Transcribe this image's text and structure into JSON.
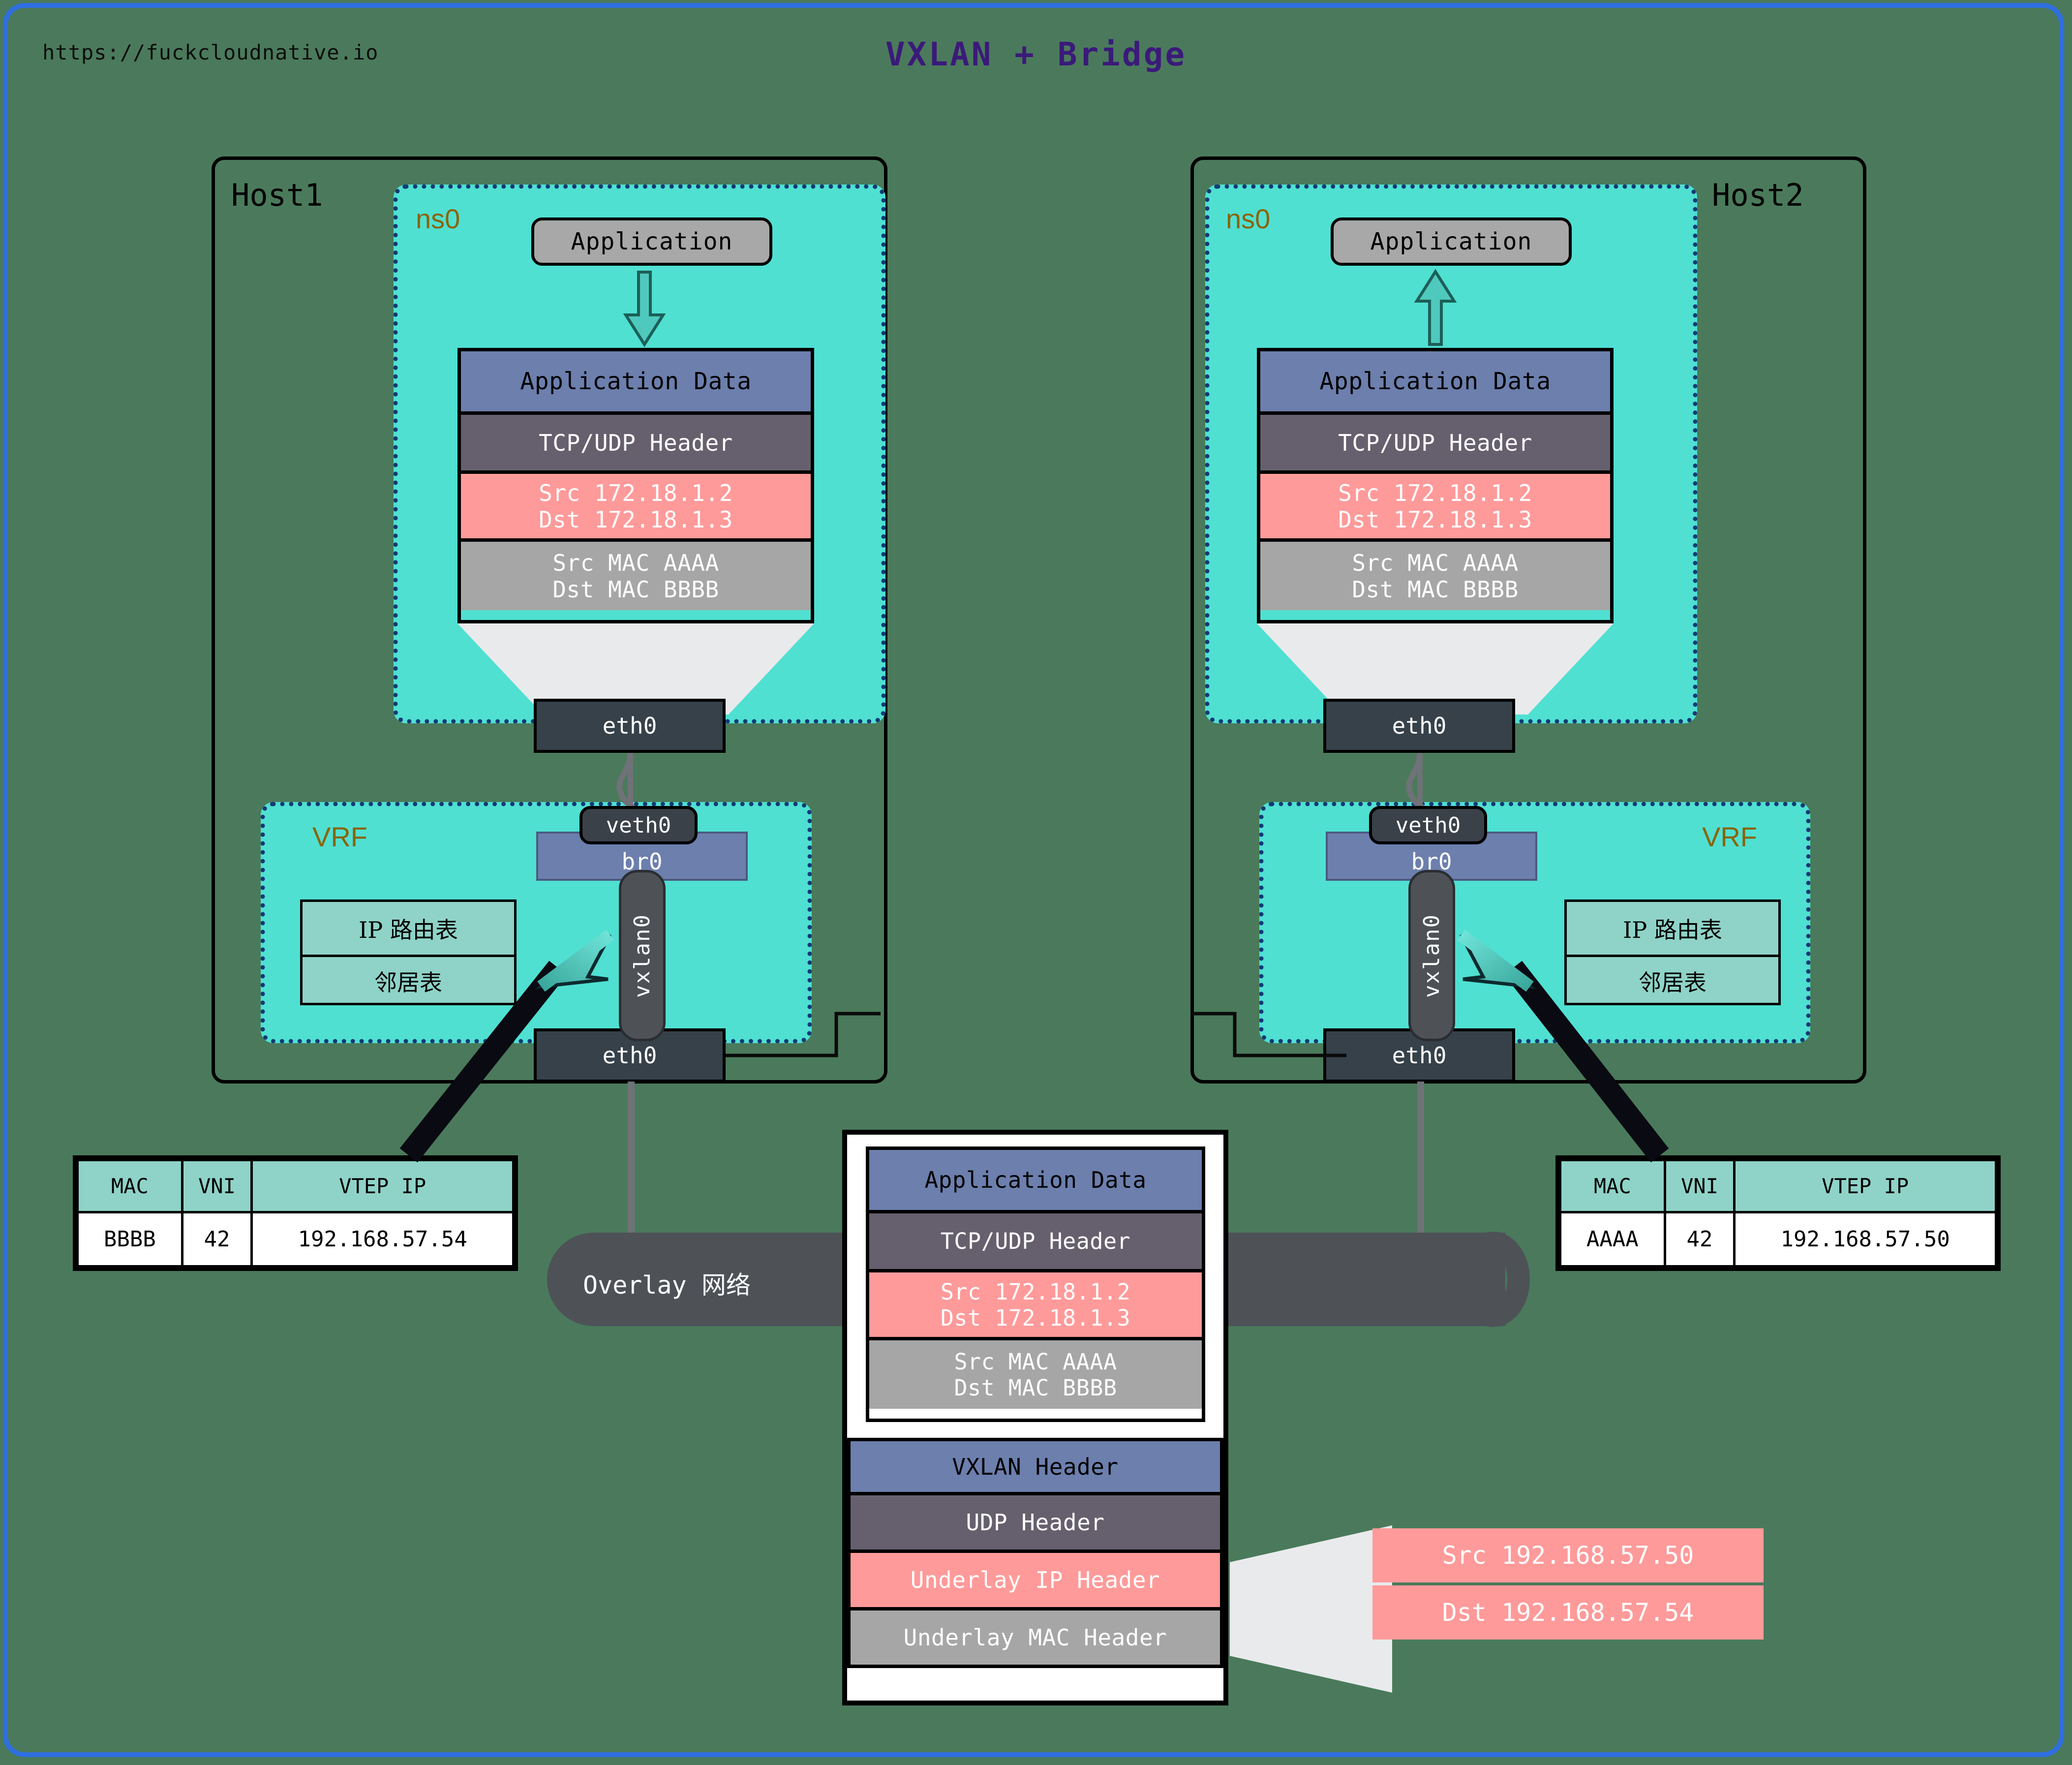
{
  "page": {
    "url": "https://fuckcloudnative.io",
    "title": "VXLAN + Bridge",
    "frame_color": "#2f6fe0",
    "background_color": "#4a7a5b"
  },
  "hosts": [
    {
      "id": "host1",
      "label": "Host1",
      "namespace_label": "ns0",
      "vrf_label": "VRF",
      "application_label": "Application",
      "arrow_direction": "down",
      "ns_eth_label": "eth0",
      "veth_label": "veth0",
      "bridge_label": "br0",
      "vxlan_label": "vxlan0",
      "host_eth_label": "eth0",
      "vrf_tables": [
        "IP 路由表",
        "邻居表"
      ],
      "packet": [
        {
          "label": "Application Data",
          "color": "#6c7fad"
        },
        {
          "label": "TCP/UDP Header",
          "color": "#66606e"
        },
        {
          "label": "Src 172.18.1.2\nDst 172.18.1.3",
          "lines": [
            "Src 172.18.1.2",
            "Dst 172.18.1.3"
          ],
          "color": "#ff9a9a"
        },
        {
          "label": "Src MAC AAAA\nDst MAC BBBB",
          "lines": [
            "Src MAC AAAA",
            "Dst MAC BBBB"
          ],
          "color": "#a6a6a6"
        }
      ]
    },
    {
      "id": "host2",
      "label": "Host2",
      "namespace_label": "ns0",
      "vrf_label": "VRF",
      "application_label": "Application",
      "arrow_direction": "up",
      "ns_eth_label": "eth0",
      "veth_label": "veth0",
      "bridge_label": "br0",
      "vxlan_label": "vxlan0",
      "host_eth_label": "eth0",
      "vrf_tables": [
        "IP 路由表",
        "邻居表"
      ],
      "packet": [
        {
          "label": "Application Data",
          "color": "#6c7fad"
        },
        {
          "label": "TCP/UDP Header",
          "color": "#66606e"
        },
        {
          "label": "Src 172.18.1.2\nDst 172.18.1.3",
          "lines": [
            "Src 172.18.1.2",
            "Dst 172.18.1.3"
          ],
          "color": "#ff9a9a"
        },
        {
          "label": "Src MAC AAAA\nDst MAC BBBB",
          "lines": [
            "Src MAC AAAA",
            "Dst MAC BBBB"
          ],
          "color": "#a6a6a6"
        }
      ]
    }
  ],
  "fdb_left": {
    "headers": [
      "MAC",
      "VNI",
      "VTEP IP"
    ],
    "rows": [
      [
        "BBBB",
        "42",
        "192.168.57.54"
      ]
    ]
  },
  "fdb_right": {
    "headers": [
      "MAC",
      "VNI",
      "VTEP IP"
    ],
    "rows": [
      [
        "AAAA",
        "42",
        "192.168.57.50"
      ]
    ]
  },
  "overlay": {
    "label": "Overlay 网络",
    "color": "#4e5257"
  },
  "encapsulated_packet": {
    "inner": [
      {
        "label": "Application Data",
        "color": "#6c7fad"
      },
      {
        "label": "TCP/UDP Header",
        "color": "#66606e"
      },
      {
        "line1": "Src 172.18.1.2",
        "line2": "Dst 172.18.1.3",
        "color": "#ff9a9a"
      },
      {
        "line1": "Src MAC AAAA",
        "line2": "Dst MAC BBBB",
        "color": "#a6a6a6"
      }
    ],
    "outer": [
      {
        "label": "VXLAN Header",
        "color": "#6c7fad"
      },
      {
        "label": "UDP Header",
        "color": "#66606e"
      },
      {
        "label": "Underlay IP Header",
        "color": "#ff9a9a"
      },
      {
        "label": "Underlay MAC Header",
        "color": "#a6a6a6"
      }
    ]
  },
  "underlay_callout": {
    "src": "Src 192.168.57.50",
    "dst": "Dst 192.168.57.54",
    "color": "#ff9a9a"
  },
  "colors": {
    "namespace_fill": "#4fe0d2",
    "namespace_border": "#123a75",
    "ns_tag": "#8a6408",
    "interface": "#36414a",
    "bridge": "#6c7fad",
    "table_header": "#8fd3c8",
    "funnel": "#e9eaec",
    "title": "#3b1a7a"
  }
}
